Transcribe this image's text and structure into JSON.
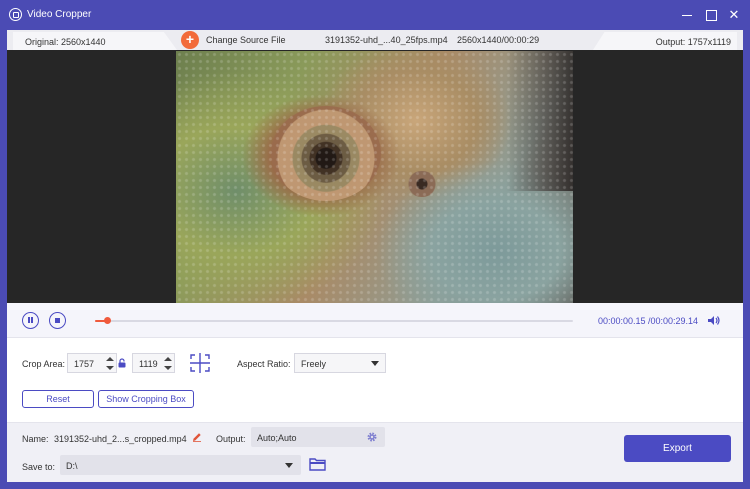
{
  "window": {
    "title": "Video Cropper",
    "icon": "app-logo-icon",
    "controls": {
      "minimize": "minimize-icon",
      "maximize": "maximize-icon",
      "close": "✕"
    }
  },
  "info_bar": {
    "original": "Original: 2560x1440",
    "change_source": "Change Source File",
    "change_source_icon": "+",
    "file_name": "3191352-uhd_...40_25fps.mp4",
    "resolution_duration": "2560x1440/00:00:29",
    "output": "Output: 1757x1119"
  },
  "playback": {
    "pause_icon": "pause-icon",
    "stop_icon": "stop-icon",
    "progress": 0.025,
    "current_time": "00:00:00.15",
    "total_time": "/00:00:29.14",
    "volume_icon": "volume-icon",
    "accent": "#f05a3c"
  },
  "crop": {
    "area_label": "Crop Area:",
    "width": "1757",
    "height": "1119",
    "lock_icon": "lock-icon",
    "center_icon": "center-crop-icon",
    "aspect_label": "Aspect Ratio:",
    "aspect_value": "Freely",
    "reset_label": "Reset",
    "show_box_label": "Show Cropping Box"
  },
  "output_settings": {
    "name_label": "Name:",
    "name_value": "3191352-uhd_2...s_cropped.mp4",
    "edit_icon": "pencil-icon",
    "output_label": "Output:",
    "output_value": "Auto;Auto",
    "settings_icon": "gear-icon",
    "saveto_label": "Save to:",
    "saveto_value": "D:\\",
    "folder_icon": "folder-icon",
    "export_label": "Export"
  },
  "colors": {
    "brand": "#4b4bb4",
    "accent_blue": "#4b4bc3",
    "add_orange": "#f26b3a"
  }
}
